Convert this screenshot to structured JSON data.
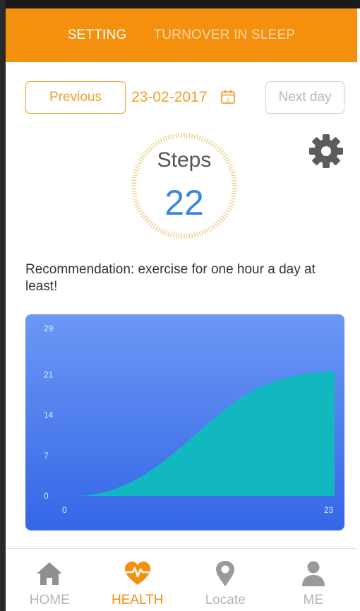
{
  "header": {
    "tabs": [
      {
        "label": "SETTING",
        "active": true
      },
      {
        "label": "TURNOVER IN SLEEP",
        "active": false
      }
    ]
  },
  "date_nav": {
    "previous_label": "Previous",
    "date": "23-02-2017",
    "calendar_day": "1",
    "next_label": "Next day"
  },
  "steps": {
    "label": "Steps",
    "value": "22"
  },
  "recommendation": "Recommendation: exercise for one hour a day at least!",
  "chart_data": {
    "type": "area",
    "title": "",
    "xlabel": "",
    "ylabel": "",
    "x_ticks": [
      0,
      23
    ],
    "y_ticks": [
      0,
      7,
      14,
      21,
      29
    ],
    "xlim": [
      0,
      23
    ],
    "ylim": [
      0,
      29
    ],
    "series": [
      {
        "x": [
          0,
          1,
          2,
          3,
          4,
          5,
          6,
          7,
          8,
          9,
          10,
          11,
          12,
          13,
          14,
          15,
          16,
          17,
          18,
          19,
          20,
          21,
          22,
          23
        ],
        "values": [
          0,
          0.1,
          0.4,
          0.9,
          1.6,
          2.5,
          3.6,
          4.9,
          6.3,
          7.9,
          9.6,
          11.3,
          13.0,
          14.6,
          16.1,
          17.4,
          18.5,
          19.4,
          20.1,
          20.6,
          21.0,
          21.3,
          21.5,
          21.6
        ]
      }
    ],
    "colors": {
      "background_top": "#6b98f5",
      "background_bottom": "#3566e6",
      "fill": "#12b8bf",
      "tick_text": "#dfe8ff"
    }
  },
  "nav": {
    "items": [
      {
        "label": "HOME",
        "icon": "home-icon",
        "active": false
      },
      {
        "label": "HEALTH",
        "icon": "heart-pulse-icon",
        "active": true
      },
      {
        "label": "Locate",
        "icon": "location-pin-icon",
        "active": false
      },
      {
        "label": "ME",
        "icon": "person-icon",
        "active": false
      }
    ]
  },
  "colors": {
    "accent": "#f5900f",
    "steps_value": "#3a86e0",
    "nav_inactive": "#b5b5b5"
  }
}
